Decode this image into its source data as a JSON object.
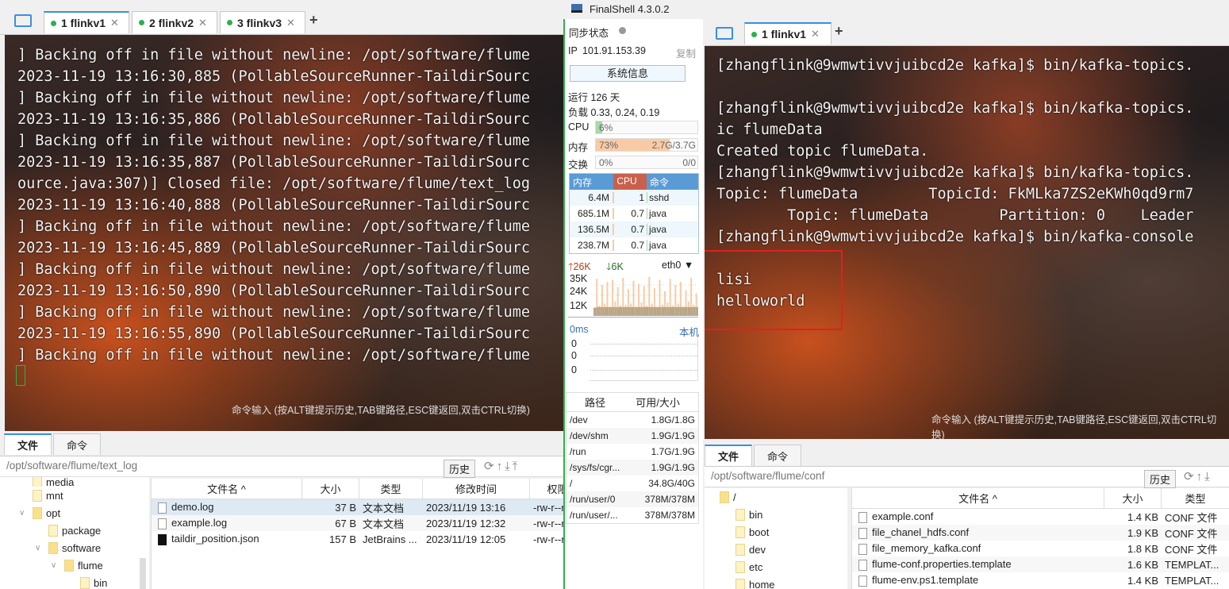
{
  "left": {
    "tabs": [
      {
        "label": "1 flinkv1"
      },
      {
        "label": "2 flinkv2"
      },
      {
        "label": "3 flinkv3"
      }
    ],
    "terminal_lines": [
      "] Backing off in file without newline: /opt/software/flume",
      "2023-11-19 13:16:30,885 (PollableSourceRunner-TaildirSourc",
      "] Backing off in file without newline: /opt/software/flume",
      "2023-11-19 13:16:35,886 (PollableSourceRunner-TaildirSourc",
      "] Backing off in file without newline: /opt/software/flume",
      "2023-11-19 13:16:35,887 (PollableSourceRunner-TaildirSourc",
      "ource.java:307)] Closed file: /opt/software/flume/text_log",
      "2023-11-19 13:16:40,888 (PollableSourceRunner-TaildirSourc",
      "] Backing off in file without newline: /opt/software/flume",
      "2023-11-19 13:16:45,889 (PollableSourceRunner-TaildirSourc",
      "] Backing off in file without newline: /opt/software/flume",
      "2023-11-19 13:16:50,890 (PollableSourceRunner-TaildirSourc",
      "] Backing off in file without newline: /opt/software/flume",
      "2023-11-19 13:16:55,890 (PollableSourceRunner-TaildirSourc",
      "] Backing off in file without newline: /opt/software/flume"
    ],
    "hint": "命令输入 (按ALT键提示历史,TAB键路径,ESC键返回,双击CTRL切换)",
    "bottom_tabs": [
      "文件",
      "命令"
    ],
    "path": "/opt/software/flume/text_log",
    "history": "历史",
    "tree": [
      {
        "label": "media",
        "depth": 1
      },
      {
        "label": "mnt",
        "depth": 1
      },
      {
        "label": "opt",
        "depth": 1,
        "open": true
      },
      {
        "label": "package",
        "depth": 2
      },
      {
        "label": "software",
        "depth": 2,
        "open": true
      },
      {
        "label": "flume",
        "depth": 3,
        "open": true
      },
      {
        "label": "bin",
        "depth": 4
      }
    ],
    "columns": [
      "文件名 ^",
      "大小",
      "类型",
      "修改时间",
      "权限"
    ],
    "files": [
      {
        "name": "demo.log",
        "size": "37 B",
        "type": "文本文档",
        "mtime": "2023/11/19 13:16",
        "perm": "-rw-r--r--"
      },
      {
        "name": "example.log",
        "size": "67 B",
        "type": "文本文档",
        "mtime": "2023/11/19 12:32",
        "perm": "-rw-r--r--"
      },
      {
        "name": "taildir_position.json",
        "size": "157 B",
        "type": "JetBrains ...",
        "mtime": "2023/11/19 12:05",
        "perm": "-rw-r--r--"
      }
    ]
  },
  "monitor": {
    "title": "FinalShell 4.3.0.2",
    "sync": "同步状态",
    "ip_label": "IP",
    "ip": "101.91.153.39",
    "copy": "复制",
    "sysinfo": "系统信息",
    "uptime": "运行 126 天",
    "load": "负载 0.33, 0.24, 0.19",
    "cpu": {
      "label": "CPU",
      "text": "6%",
      "percent": 6
    },
    "mem": {
      "label": "内存",
      "text": "73%",
      "detail": "2.7G/3.7G",
      "percent": 73
    },
    "swap": {
      "label": "交换",
      "text": "0%",
      "detail": "0/0",
      "percent": 0
    },
    "proc_headers": [
      "内存",
      "CPU",
      "命令"
    ],
    "procs": [
      {
        "mem": "6.4M",
        "cpu": "1",
        "cmd": "sshd"
      },
      {
        "mem": "685.1M",
        "cpu": "0.7",
        "cmd": "java"
      },
      {
        "mem": "136.5M",
        "cpu": "0.7",
        "cmd": "java"
      },
      {
        "mem": "238.7M",
        "cpu": "0.7",
        "cmd": "java"
      }
    ],
    "net": {
      "up": "26K",
      "down": "6K",
      "iface": "eth0",
      "ticks": [
        "35K",
        "24K",
        "12K"
      ],
      "samples": [
        8,
        36,
        10,
        30,
        12,
        33,
        9,
        35,
        14,
        28,
        10,
        37,
        11,
        26,
        12,
        34,
        9,
        31,
        13,
        29,
        10,
        38,
        12,
        27,
        9,
        35,
        11,
        24,
        13,
        36,
        10,
        30,
        12,
        33,
        9,
        25,
        14,
        37,
        11,
        22
      ]
    },
    "ping": {
      "latency": "0ms",
      "host": "本机",
      "ticks": [
        "0",
        "0",
        "0"
      ]
    },
    "disk_headers": [
      "路径",
      "可用/大小"
    ],
    "disks": [
      {
        "path": "/dev",
        "size": "1.8G/1.8G"
      },
      {
        "path": "/dev/shm",
        "size": "1.9G/1.9G"
      },
      {
        "path": "/run",
        "size": "1.7G/1.9G"
      },
      {
        "path": "/sys/fs/cgr...",
        "size": "1.9G/1.9G"
      },
      {
        "path": "/",
        "size": "34.8G/40G"
      },
      {
        "path": "/run/user/0",
        "size": "378M/378M"
      },
      {
        "path": "/run/user/...",
        "size": "378M/378M"
      }
    ]
  },
  "right": {
    "tabs": [
      {
        "label": "1 flinkv1"
      }
    ],
    "terminal_lines": [
      "[zhangflink@9wmwtivvjuibcd2e kafka]$ bin/kafka-topics.",
      "",
      "[zhangflink@9wmwtivvjuibcd2e kafka]$ bin/kafka-topics.",
      "ic flumeData",
      "Created topic flumeData.",
      "[zhangflink@9wmwtivvjuibcd2e kafka]$ bin/kafka-topics.",
      "Topic: flumeData        TopicId: FkMLka7ZS2eKWh0qd9rm7",
      "        Topic: flumeData        Partition: 0    Leader",
      "[zhangflink@9wmwtivvjuibcd2e kafka]$ bin/kafka-console",
      "",
      "lisi",
      "helloworld"
    ],
    "hint": "命令输入 (按ALT键提示历史,TAB键路径,ESC键返回,双击CTRL切换)",
    "bottom_tabs": [
      "文件",
      "命令"
    ],
    "path": "/opt/software/flume/conf",
    "history": "历史",
    "tree": [
      {
        "label": "/",
        "depth": 0,
        "open": true
      },
      {
        "label": "bin",
        "depth": 1
      },
      {
        "label": "boot",
        "depth": 1
      },
      {
        "label": "dev",
        "depth": 1
      },
      {
        "label": "etc",
        "depth": 1
      },
      {
        "label": "home",
        "depth": 1
      }
    ],
    "columns": [
      "文件名 ^",
      "大小",
      "类型"
    ],
    "files": [
      {
        "name": "example.conf",
        "size": "1.4 KB",
        "type": "CONF 文件"
      },
      {
        "name": "file_chanel_hdfs.conf",
        "size": "1.9 KB",
        "type": "CONF 文件"
      },
      {
        "name": "file_memory_kafka.conf",
        "size": "1.8 KB",
        "type": "CONF 文件"
      },
      {
        "name": "flume-conf.properties.template",
        "size": "1.6 KB",
        "type": "TEMPLAT..."
      },
      {
        "name": "flume-env.ps1.template",
        "size": "1.4 KB",
        "type": "TEMPLAT..."
      }
    ]
  },
  "colors": {
    "accent": "#3a8ee6",
    "connected": "#2bb24c",
    "highlight_box": "#e02020",
    "mem_bar": "#f8cba6",
    "cpu_bar": "#a8d8a8",
    "proc_header_blue": "#5b9bd5",
    "proc_header_red": "#c8604c"
  }
}
